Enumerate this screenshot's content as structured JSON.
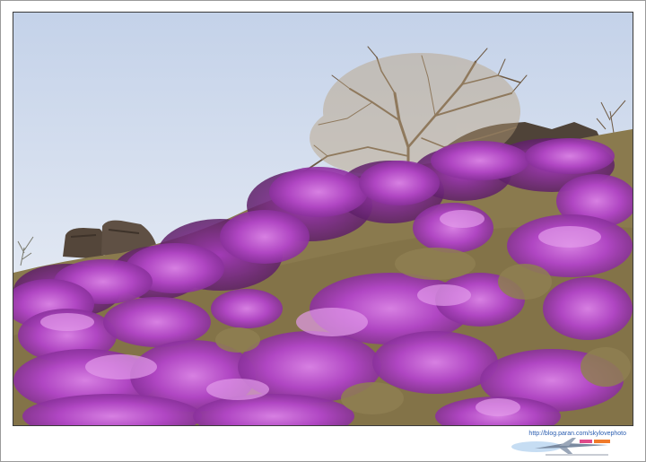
{
  "photo": {
    "subject": "flowering-hillside",
    "colors": {
      "sky_top": "#c9d6ea",
      "sky_bottom": "#f1f3f8",
      "blossom": "#b347c4",
      "blossom_light": "#d37ade",
      "blossom_dark": "#7d2a8c",
      "grass": "#8a7a4e",
      "rock": "#5a4c40",
      "tree_branches": "#6e5a44"
    }
  },
  "watermark": {
    "url": "http://blog.paran.com/skylovephoto",
    "logo_icon": "airplane-logo-icon"
  }
}
